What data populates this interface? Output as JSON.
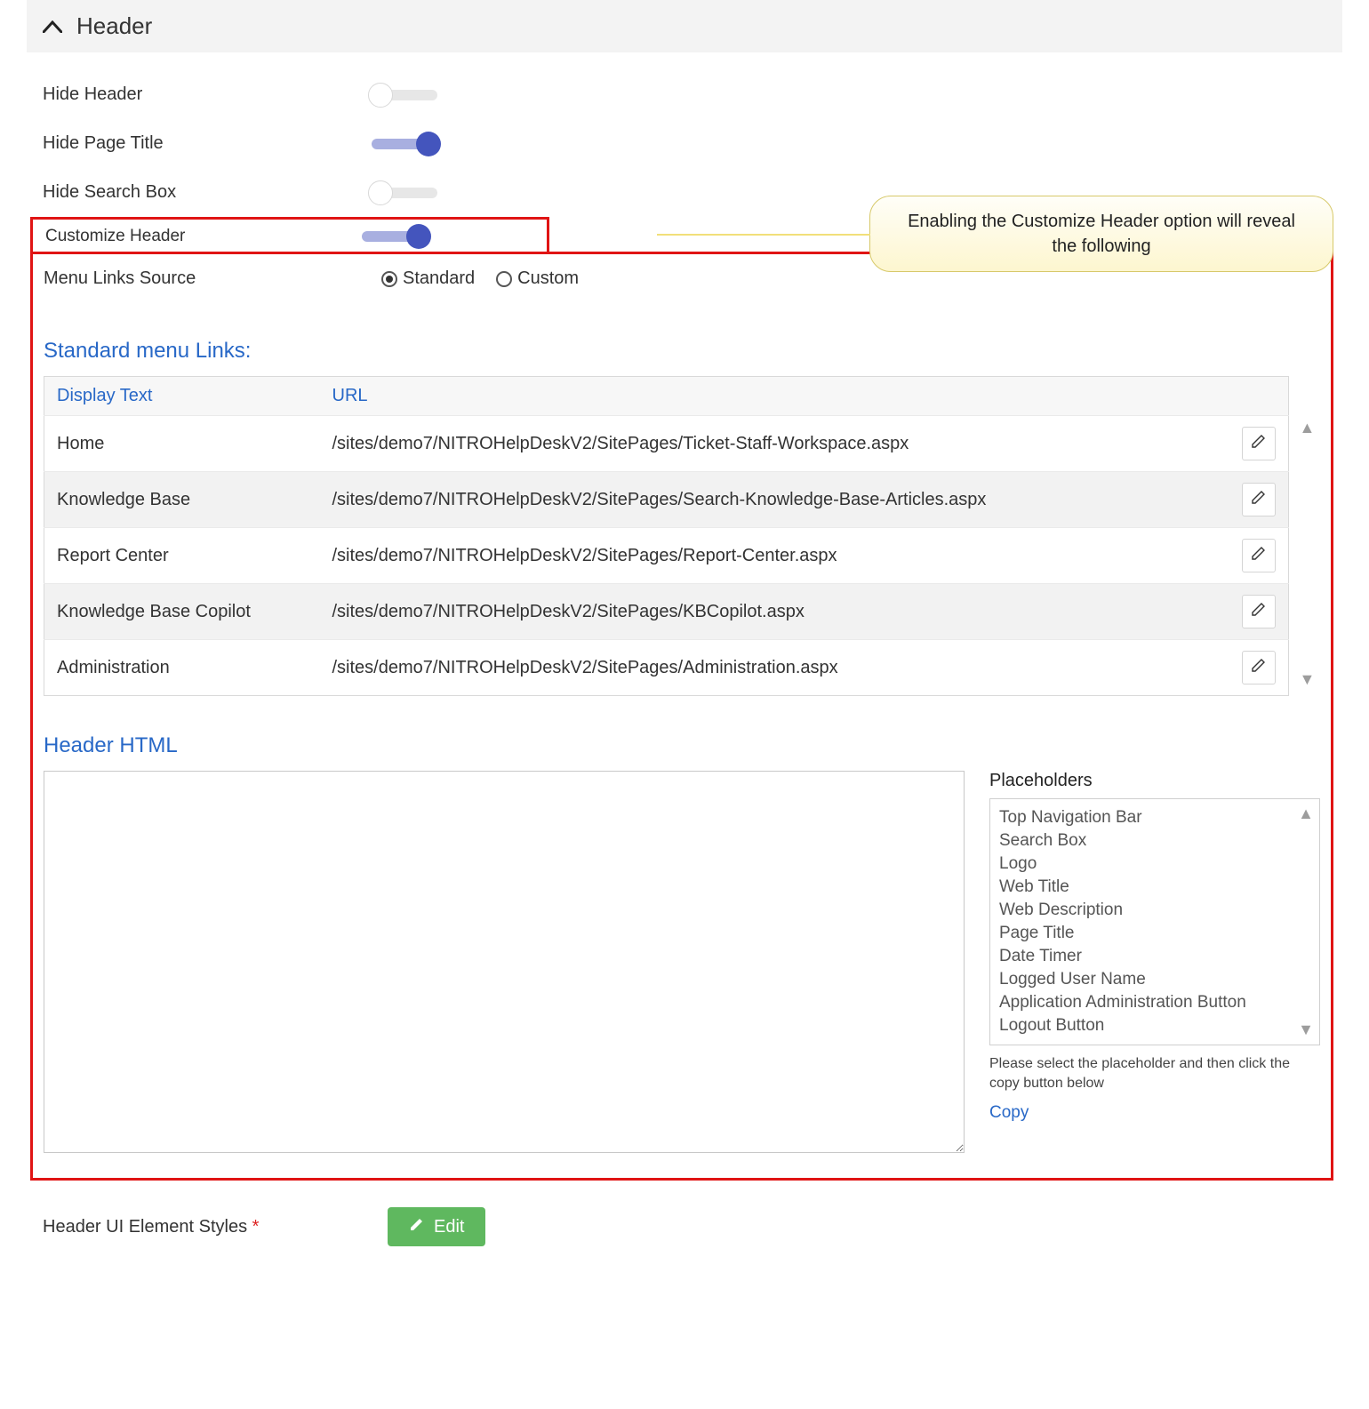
{
  "section": {
    "title": "Header"
  },
  "toggles": {
    "hideHeader": {
      "label": "Hide Header",
      "on": false
    },
    "hidePageTitle": {
      "label": "Hide Page Title",
      "on": true
    },
    "hideSearchBox": {
      "label": "Hide Search Box",
      "on": false
    },
    "customizeHeader": {
      "label": "Customize Header",
      "on": true
    }
  },
  "callout": "Enabling the Customize Header option will reveal the following",
  "menuLinksSource": {
    "label": "Menu Links Source",
    "options": {
      "standard": "Standard",
      "custom": "Custom"
    },
    "selected": "standard"
  },
  "standardMenu": {
    "heading": "Standard menu Links:",
    "columns": {
      "display": "Display Text",
      "url": "URL"
    },
    "rows": [
      {
        "display": "Home",
        "url": "/sites/demo7/NITROHelpDeskV2/SitePages/Ticket-Staff-Workspace.aspx"
      },
      {
        "display": "Knowledge Base",
        "url": "/sites/demo7/NITROHelpDeskV2/SitePages/Search-Knowledge-Base-Articles.aspx"
      },
      {
        "display": "Report Center",
        "url": "/sites/demo7/NITROHelpDeskV2/SitePages/Report-Center.aspx"
      },
      {
        "display": "Knowledge Base Copilot",
        "url": "/sites/demo7/NITROHelpDeskV2/SitePages/KBCopilot.aspx"
      },
      {
        "display": "Administration",
        "url": "/sites/demo7/NITROHelpDeskV2/SitePages/Administration.aspx"
      }
    ]
  },
  "headerHtml": {
    "heading": "Header HTML",
    "value": ""
  },
  "placeholders": {
    "title": "Placeholders",
    "items": [
      "Top Navigation Bar",
      "Search Box",
      "Logo",
      "Web Title",
      "Web Description",
      "Page Title",
      "Date Timer",
      "Logged User Name",
      "Application Administration Button",
      "Logout Button"
    ],
    "help": "Please select the placeholder and then click the copy button below",
    "copy": "Copy"
  },
  "uiStyles": {
    "label": "Header UI Element Styles",
    "button": "Edit"
  }
}
